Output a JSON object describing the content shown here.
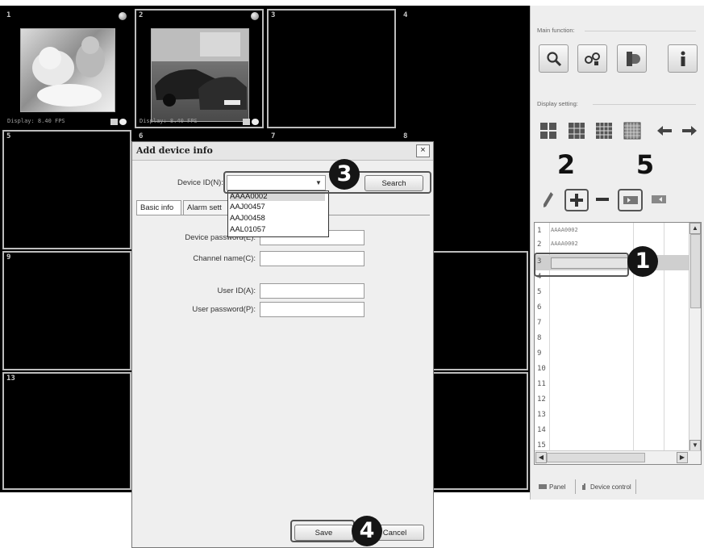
{
  "grid": {
    "cells": [
      {
        "label": "1"
      },
      {
        "label": "2"
      },
      {
        "label": "3"
      },
      {
        "label": "4"
      },
      {
        "label": "5"
      },
      {
        "label": "6"
      },
      {
        "label": "7"
      },
      {
        "label": "8"
      },
      {
        "label": "9"
      },
      {
        "label": "13"
      }
    ],
    "fps1": "Display: 8.40 FPS",
    "fps2": "Display: 8.40 FPS"
  },
  "panel": {
    "main_function_title": "Main function:",
    "display_setting_title": "Display setting:",
    "main_buttons": [
      "search-icon",
      "cameras-icon",
      "recorder-icon",
      "info-icon"
    ],
    "devices": [
      {
        "num": "1",
        "id": "AAAA0002"
      },
      {
        "num": "2",
        "id": "AAAA0002"
      },
      {
        "num": "3",
        "id": ""
      },
      {
        "num": "4",
        "id": ""
      },
      {
        "num": "5",
        "id": ""
      },
      {
        "num": "6",
        "id": ""
      },
      {
        "num": "7",
        "id": ""
      },
      {
        "num": "8",
        "id": ""
      },
      {
        "num": "9",
        "id": ""
      },
      {
        "num": "10",
        "id": ""
      },
      {
        "num": "11",
        "id": ""
      },
      {
        "num": "12",
        "id": ""
      },
      {
        "num": "13",
        "id": ""
      },
      {
        "num": "14",
        "id": ""
      },
      {
        "num": "15",
        "id": ""
      }
    ],
    "tab_panel": "Panel",
    "tab_device_control": "Device control"
  },
  "dialog": {
    "title": "Add device info",
    "close": "×",
    "device_id_label": "Device ID(N):",
    "device_id_value": "",
    "search_button": "Search",
    "dropdown_options": [
      "AAAA0002",
      "AAJ00457",
      "AAJ00458",
      "AAL01057"
    ],
    "tab_basic": "Basic info",
    "tab_alarm": "Alarm sett",
    "device_password_label": "Device password(E):",
    "channel_name_label": "Channel name(C):",
    "user_id_label": "User ID(A):",
    "user_password_label": "User password(P):",
    "save_button": "Save",
    "cancel_button": "Cancel"
  },
  "steps": [
    "1",
    "2",
    "3",
    "4",
    "5"
  ],
  "colors": {
    "grid_bg": "#000000",
    "panel_bg": "#eeeeee",
    "dialog_bg": "#efefef"
  }
}
